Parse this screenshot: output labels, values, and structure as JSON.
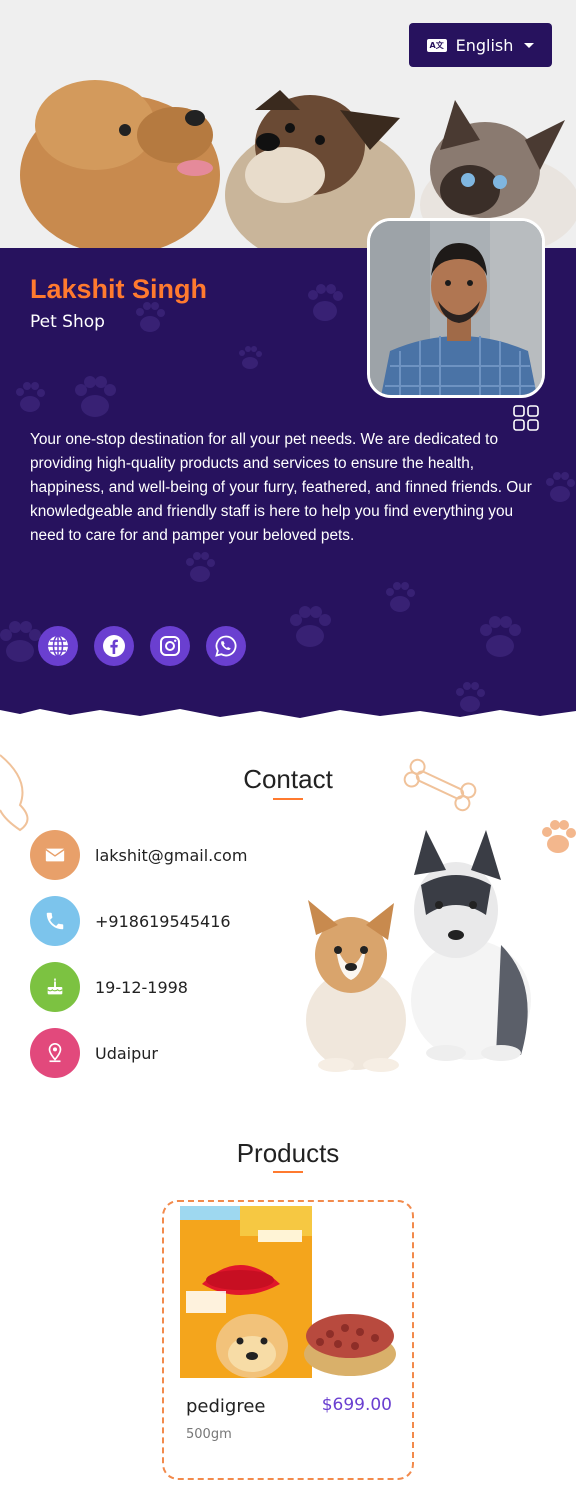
{
  "language": {
    "label": "English",
    "icon": "translate-icon"
  },
  "profile": {
    "name": "Lakshit Singh",
    "role": "Pet Shop",
    "about": "Your one-stop destination for all your pet needs. We are dedicated to providing high-quality products and services to ensure the health, happiness, and well-being of your furry, feathered, and finned friends. Our knowledgeable and friendly staff is here to help you find everything you need to care for and pamper your beloved pets.",
    "social": [
      "globe-icon",
      "facebook-icon",
      "instagram-icon",
      "whatsapp-icon"
    ]
  },
  "contact": {
    "title": "Contact",
    "items": [
      {
        "icon": "email-icon",
        "value": "lakshit@gmail.com",
        "color": "#e8a06a"
      },
      {
        "icon": "phone-icon",
        "value": "+918619545416",
        "color": "#7cc4ec"
      },
      {
        "icon": "cake-icon",
        "value": "19-12-1998",
        "color": "#7cc241"
      },
      {
        "icon": "location-icon",
        "value": "Udaipur",
        "color": "#e2497c"
      }
    ]
  },
  "products": {
    "title": "Products",
    "items": [
      {
        "name": "pedigree",
        "price": "$699.00",
        "quantity": "500gm"
      }
    ]
  },
  "colors": {
    "primary": "#27125e",
    "accent": "#ff7a2f",
    "social": "#6a3fd0"
  }
}
